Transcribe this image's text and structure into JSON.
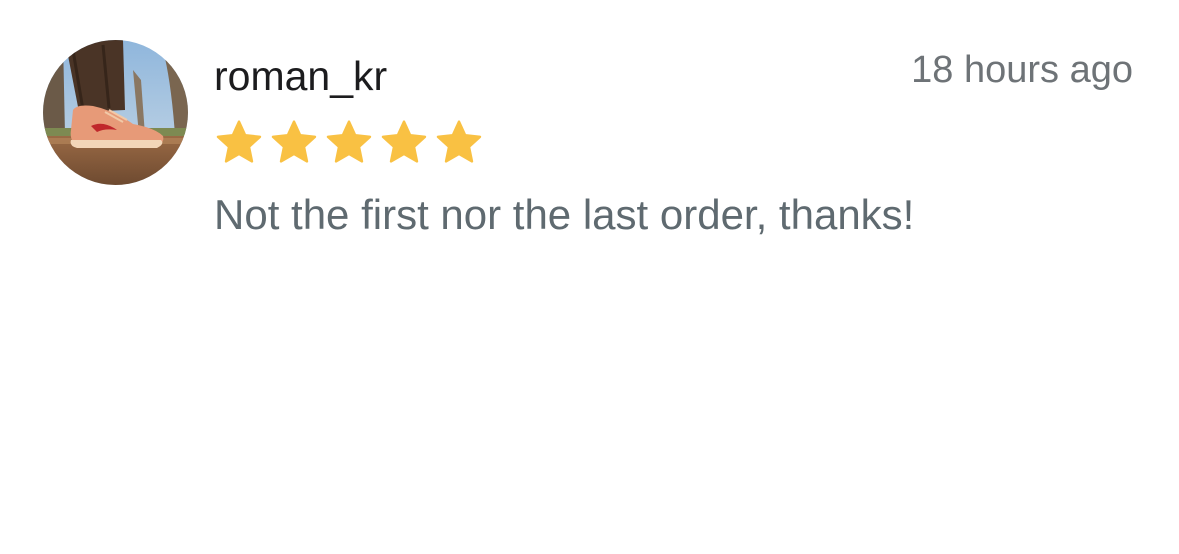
{
  "review": {
    "username": "roman_kr",
    "timestamp": "18 hours ago",
    "rating": 5,
    "star_count": 5,
    "star_color": "#f9c143",
    "text": "Not the first nor the last order, thanks!"
  },
  "avatar": {
    "icon": "user-avatar-photo-sneaker"
  }
}
